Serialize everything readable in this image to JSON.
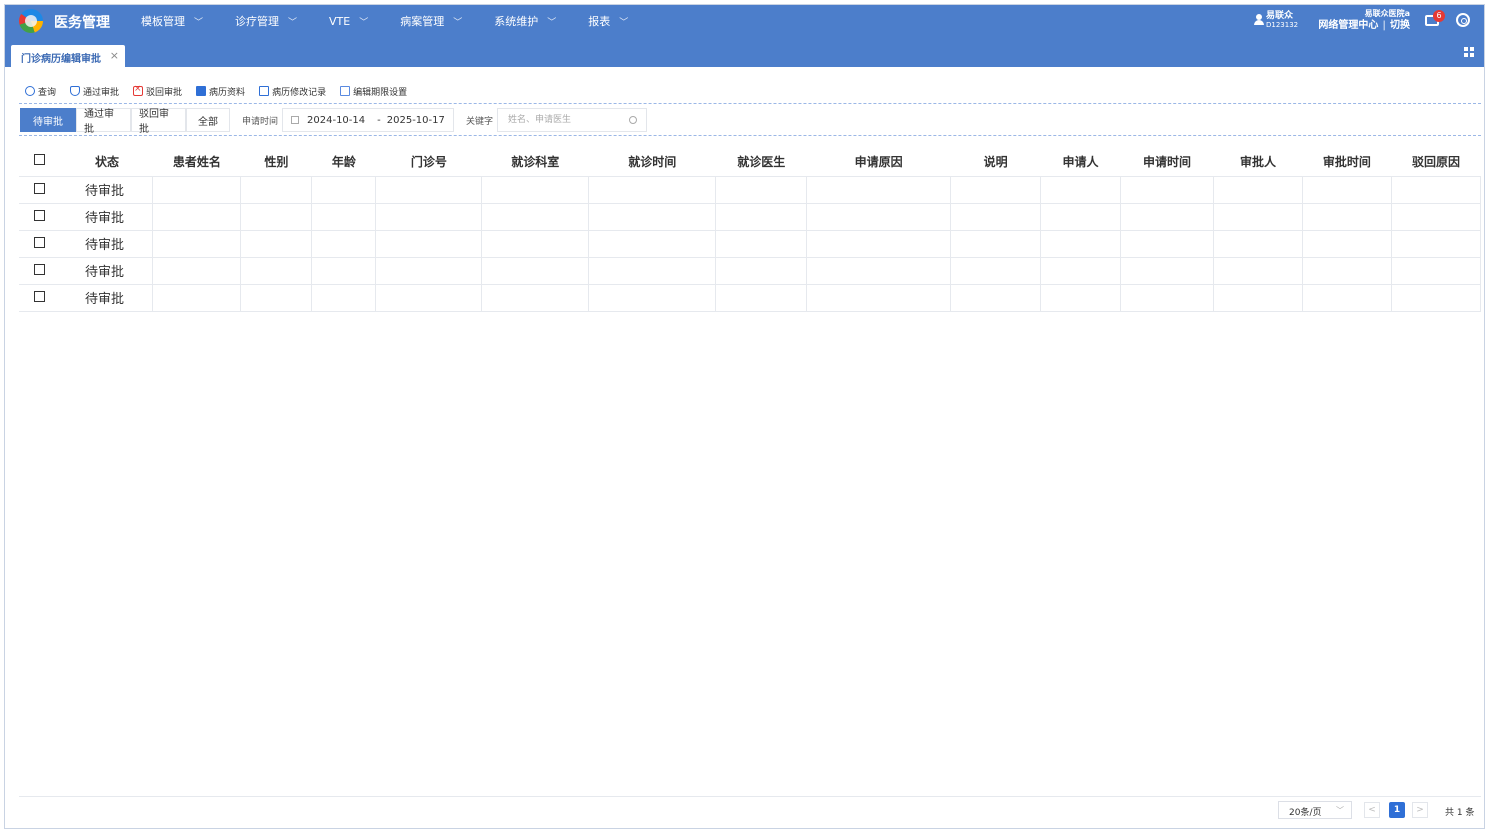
{
  "app": {
    "title": "医务管理"
  },
  "nav": [
    {
      "label": "模板管理",
      "active": false
    },
    {
      "label": "诊疗管理",
      "active": false
    },
    {
      "label": "VTE",
      "active": false
    },
    {
      "label": "病案管理",
      "active": true
    },
    {
      "label": "系统维护",
      "active": false
    },
    {
      "label": "报表",
      "active": false
    }
  ],
  "user": {
    "name": "易联众",
    "id": "D123132",
    "hospital": "易联众医院a",
    "department": "网络管理中心",
    "switch_label": "切换"
  },
  "notifications": {
    "count": "6"
  },
  "tab": {
    "label": "门诊病历编辑审批",
    "close": "×"
  },
  "toolbar": {
    "query": "查询",
    "approve": "通过审批",
    "reject": "驳回审批",
    "record_info": "病历资料",
    "edit_log": "病历修改记录",
    "edit_deadline": "编辑期限设置"
  },
  "filters": {
    "segments": [
      {
        "label": "待审批",
        "active": true
      },
      {
        "label": "通过审批",
        "active": false
      },
      {
        "label": "驳回审批",
        "active": false
      },
      {
        "label": "全部",
        "active": false
      }
    ],
    "date_label": "申请时间",
    "date_start": "2024-10-14",
    "date_separator": "-",
    "date_end": "2025-10-17",
    "keyword_label": "关键字",
    "keyword_placeholder": "姓名、申请医生"
  },
  "table": {
    "columns": [
      "状态",
      "患者姓名",
      "性别",
      "年龄",
      "门诊号",
      "就诊科室",
      "就诊时间",
      "就诊医生",
      "申请原因",
      "说明",
      "申请人",
      "申请时间",
      "审批人",
      "审批时间",
      "驳回原因"
    ],
    "rows": [
      {
        "状态": "待审批"
      },
      {
        "状态": "待审批"
      },
      {
        "状态": "待审批"
      },
      {
        "状态": "待审批"
      },
      {
        "状态": "待审批"
      }
    ]
  },
  "pagination": {
    "page_size": "20条/页",
    "current_page": "1",
    "total": "共 1 条",
    "prev": "<",
    "next": ">"
  },
  "colors": {
    "primary": "#4c7ecb",
    "active_nav": "#3c6ab4",
    "page_button": "#2f6fd6",
    "badge": "#e53935"
  }
}
